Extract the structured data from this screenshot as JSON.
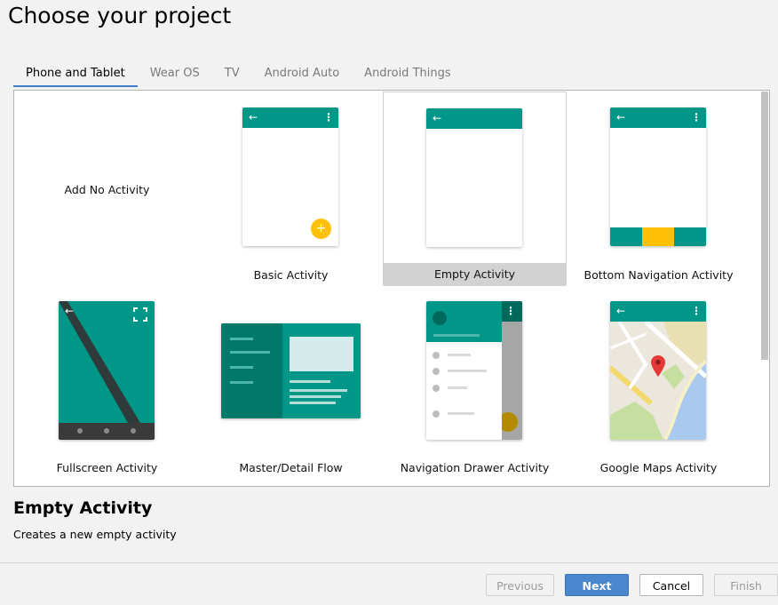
{
  "page_title": "Choose your project",
  "tabs": [
    "Phone and Tablet",
    "Wear OS",
    "TV",
    "Android Auto",
    "Android Things"
  ],
  "selected_tab": "Phone and Tablet",
  "templates": [
    {
      "label": "Add No Activity"
    },
    {
      "label": "Basic Activity"
    },
    {
      "label": "Empty Activity",
      "selected": true
    },
    {
      "label": "Bottom Navigation Activity"
    },
    {
      "label": "Fullscreen Activity"
    },
    {
      "label": "Master/Detail Flow"
    },
    {
      "label": "Navigation Drawer Activity"
    },
    {
      "label": "Google Maps Activity"
    }
  ],
  "selected_template": {
    "title": "Empty Activity",
    "description": "Creates a new empty activity"
  },
  "buttons": {
    "previous": "Previous",
    "next": "Next",
    "cancel": "Cancel",
    "finish": "Finish"
  },
  "colors": {
    "accent": "#009688",
    "fab": "#ffc107",
    "primary_button": "#4b87cf",
    "tab_underline": "#3d7fc9"
  },
  "icons": [
    "back-arrow-icon",
    "overflow-menu-icon",
    "plus-icon",
    "fullscreen-icon",
    "map-pin-icon"
  ]
}
